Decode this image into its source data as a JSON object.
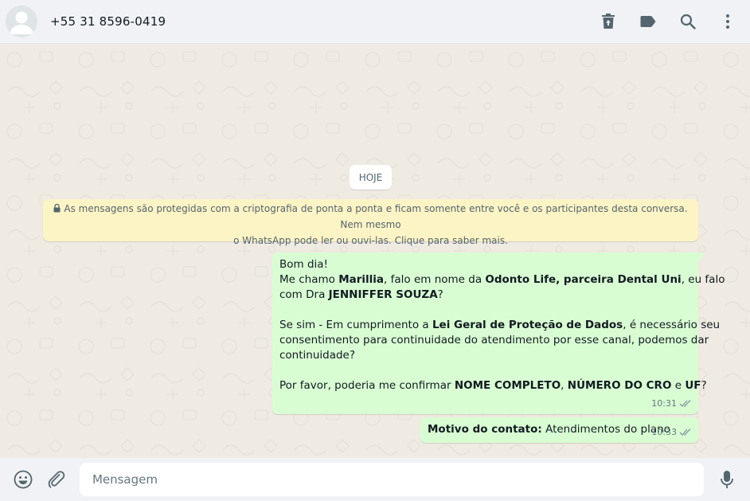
{
  "header": {
    "contact_name": "+55 31 8596-0419",
    "actions": [
      {
        "icon": "delete-icon"
      },
      {
        "icon": "label-icon"
      },
      {
        "icon": "search-icon"
      },
      {
        "icon": "menu-icon"
      }
    ]
  },
  "chat": {
    "date_chip": "HOJE",
    "encryption_notice_line1": "As mensagens são protegidas com a criptografia de ponta a ponta e ficam somente entre você e os participantes desta conversa. Nem mesmo",
    "encryption_notice_line2": "o WhatsApp pode ler ou ouvi-las. Clique para saber mais.",
    "messages": [
      {
        "direction": "outgoing",
        "l1": "Bom dia!",
        "l2a": "Me chamo ",
        "l2b": "Marillia",
        "l2c": ", falo em nome da ",
        "l2d": "Odonto Life, parceira Dental Uni",
        "l2e": ", eu falo",
        "l3a": "com Dra ",
        "l3b": "JENNIFFER SOUZA",
        "l3c": "?",
        "l4a": "Se sim - Em cumprimento a ",
        "l4b": "Lei Geral de Proteção de Dados",
        "l4c": ", é necessário seu",
        "l5": "consentimento para continuidade do atendimento por esse canal, podemos dar",
        "l6": "continuidade?",
        "l7a": "Por favor, poderia me confirmar ",
        "l7b": "NOME COMPLETO",
        "l7c": ", ",
        "l7d": "NÚMERO DO CRO",
        "l7e": " e ",
        "l7f": "UF",
        "l7g": "?",
        "time": "10:31",
        "status": "read"
      },
      {
        "direction": "outgoing",
        "label": "Motivo do contato:",
        "text": " Atendimentos do plano",
        "time": "10:33",
        "status": "read"
      }
    ]
  },
  "footer": {
    "placeholder": "Mensagem",
    "emoji_icon": "emoji-icon",
    "attach_icon": "paperclip-icon",
    "mic_icon": "microphone-icon"
  },
  "colors": {
    "header_bg": "#f0f2f5",
    "chat_bg": "#efeae2",
    "outgoing_bubble": "#d9fdd3",
    "notice_bg": "#fdf4c5",
    "icon_gray": "#54656f"
  }
}
